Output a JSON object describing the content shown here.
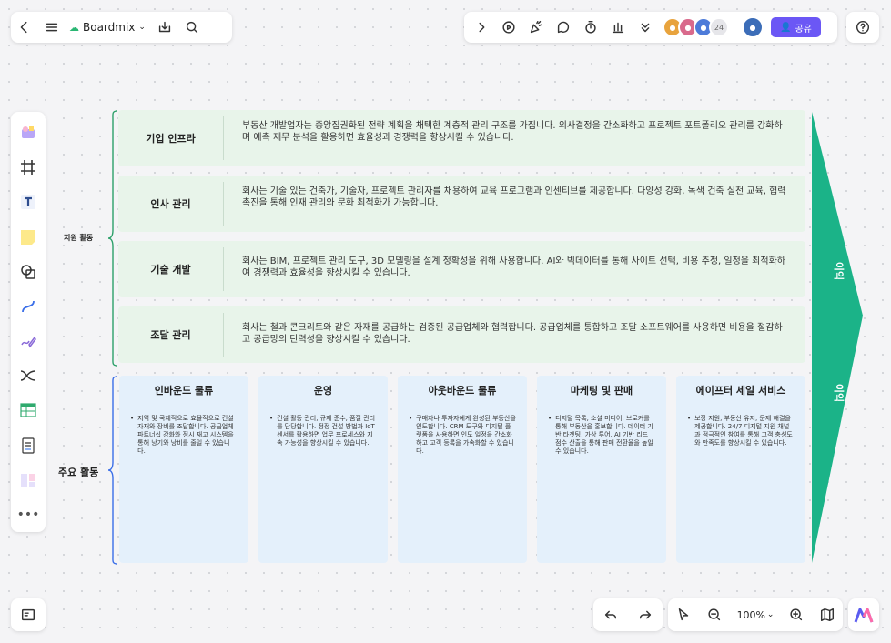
{
  "toolbar_left": {
    "brand": "Boardmix"
  },
  "toolbar_right": {
    "avatar_count": "24",
    "share_label": "공유"
  },
  "zoom": {
    "level": "100%"
  },
  "diagram": {
    "support_label": "지원 활동",
    "primary_label": "주요 활동",
    "margin_labels": [
      "이익",
      "이익"
    ],
    "support_rows": [
      {
        "title": "기업 인프라",
        "desc": "부동산 개발업자는 중앙집권화된 전략 계획을 채택한 계층적 관리 구조를 가집니다. 의사결정을 간소화하고 프로젝트 포트폴리오 관리를 강화하며 예측 재무 분석을 활용하면 효율성과 경쟁력을 향상시킬 수 있습니다."
      },
      {
        "title": "인사 관리",
        "desc": "회사는 기술 있는 건축가, 기술자, 프로젝트 관리자를 채용하여 교육 프로그램과 인센티브를 제공합니다. 다양성 강화, 녹색 건축 실천 교육, 협력 촉진을 통해 인재 관리와 문화 최적화가 가능합니다."
      },
      {
        "title": "기술 개발",
        "desc": "회사는 BIM, 프로젝트 관리 도구, 3D 모델링을 설계 정확성을 위해 사용합니다. AI와 빅데이터를 통해 사이트 선택, 비용 추정, 일정을 최적화하여 경쟁력과 효율성을 향상시킬 수 있습니다."
      },
      {
        "title": "조달 관리",
        "desc": "회사는 철과 콘크리트와 같은 자재를 공급하는 검증된 공급업체와 협력합니다. 공급업체를 통합하고 조달 소프트웨어를 사용하면 비용을 절감하고 공급망의 탄력성을 향상시킬 수 있습니다."
      }
    ],
    "primary_cards": [
      {
        "title": "인바운드 물류",
        "body": "지역 및 국제적으로 효율적으로 건설 자재와 장비를 조달합니다. 공급업체 파트너십 강화와 정시 재고 시스템을 통해 낭기와 낭비를 줄일 수 있습니다."
      },
      {
        "title": "운영",
        "body": "건설 활동 관리, 규제 준수, 품질 관리를 담당합니다. 정정 건설 방법과 IoT 센서를 활용하면 업무 프로세스와 지속 가능성을 향상시킬 수 있습니다."
      },
      {
        "title": "아웃바운드 물류",
        "body": "구매자나 투자자에게 완성된 부동산을 인도합니다. CRM 도구와 디지털 플랫폼을 사용하면 인도 일정을 간소화하고 고객 등록을 가속화할 수 있습니다."
      },
      {
        "title": "마케팅 및 판매",
        "body": "디지털 목록, 소셜 미디어, 브로커를 통해 부동산을 홍보합니다. 데이터 기반 타겟팅, 가상 투어, AI 기반 리드 점수 산출을 통해 판매 전환율을 높일 수 있습니다."
      },
      {
        "title": "에이프터 세일 서비스",
        "body": "보장 지원, 부동산 유지, 문제 해결을 제공합니다. 24/7 디지털 지원 채널과 적극적인 참여를 통해 고객 충성도와 만족도를 향상시킬 수 있습니다."
      }
    ]
  }
}
